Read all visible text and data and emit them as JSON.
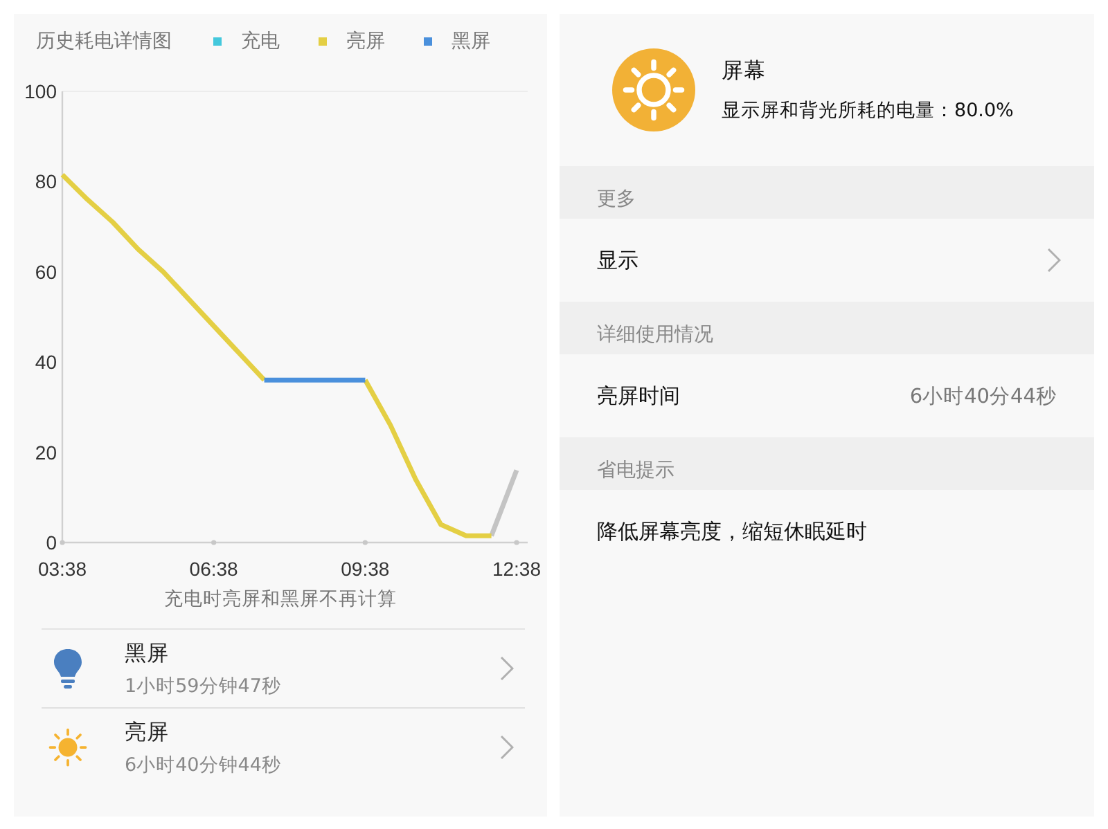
{
  "history": {
    "title": "历史耗电详情图",
    "legend": [
      {
        "label": "充电",
        "color": "#44c8dc"
      },
      {
        "label": "亮屏",
        "color": "#e4cf44"
      },
      {
        "label": "黑屏",
        "color": "#4a90dc"
      }
    ],
    "chart_data": {
      "type": "line",
      "ylim": [
        0,
        100
      ],
      "yticks": [
        0,
        20,
        40,
        60,
        80,
        100
      ],
      "categories": [
        "03:38",
        null,
        null,
        null,
        null,
        null,
        "06:38",
        null,
        null,
        null,
        null,
        null,
        "09:38",
        null,
        null,
        null,
        null,
        null,
        "12:38"
      ],
      "series": [
        {
          "color": "#c4c4c4",
          "values": [
            null,
            null,
            null,
            null,
            null,
            null,
            null,
            null,
            null,
            null,
            null,
            null,
            null,
            null,
            null,
            null,
            null,
            1.5,
            16
          ]
        },
        {
          "color": "#e4cf44",
          "values": [
            81.5,
            76,
            71,
            65,
            60,
            54,
            48,
            42,
            36,
            null,
            null,
            null,
            36,
            26,
            14,
            4,
            1.5,
            1.5,
            null
          ]
        },
        {
          "color": "#4a90dc",
          "values": [
            null,
            null,
            null,
            null,
            null,
            null,
            null,
            null,
            36,
            36,
            36,
            36,
            36,
            null,
            null,
            null,
            null,
            null,
            null
          ]
        }
      ]
    },
    "note": "充电时亮屏和黑屏不再计算",
    "items": [
      {
        "kind": "bulb",
        "title": "黑屏",
        "duration": "1小时59分钟47秒"
      },
      {
        "kind": "sun",
        "title": "亮屏",
        "duration": "6小时40分钟44秒"
      }
    ]
  },
  "detail": {
    "title": "屏幕",
    "description": "显示屏和背光所耗的电量：80.0%",
    "sections": [
      {
        "header": "更多",
        "rows": [
          {
            "kind": "link",
            "label": "显示"
          }
        ]
      },
      {
        "header": "详细使用情况",
        "rows": [
          {
            "kind": "value",
            "label": "亮屏时间",
            "value": "6小时40分44秒"
          }
        ]
      },
      {
        "header": "省电提示",
        "rows": [
          {
            "kind": "text",
            "label": "降低屏幕亮度，缩短休眠延时"
          }
        ]
      }
    ]
  }
}
